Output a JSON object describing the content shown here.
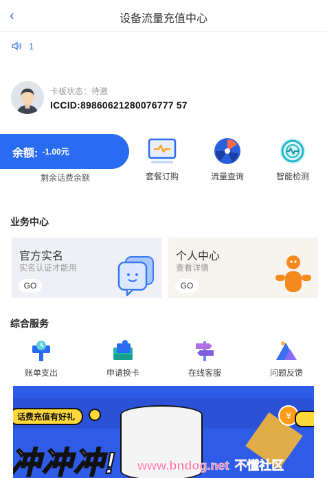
{
  "header": {
    "title": "设备流量充值中心"
  },
  "notice": {
    "text": "1"
  },
  "profile": {
    "status": "卡板状态：待激",
    "iccid": "ICCID:89860621280076777 57"
  },
  "balance": {
    "label": "余额:",
    "amount": "-1.00元",
    "caption": "剩余话费余额"
  },
  "quick_actions": [
    {
      "label": "套餐订购",
      "icon": "monitor-icon"
    },
    {
      "label": "流量查询",
      "icon": "fan-icon"
    },
    {
      "label": "智能检测",
      "icon": "radar-icon"
    }
  ],
  "business": {
    "title": "业务中心",
    "cards": [
      {
        "title": "官方实名",
        "subtitle": "实名认证才能用",
        "go": "GO",
        "icon": "chat-smile-icon",
        "bg": "#eef0f6"
      },
      {
        "title": "个人中心",
        "subtitle": "查看详情",
        "go": "GO",
        "icon": "person-icon",
        "bg": "#f7f3ee"
      }
    ]
  },
  "services": {
    "title": "综合服务",
    "items": [
      {
        "label": "账单支出",
        "icon": "bill-pin-icon"
      },
      {
        "label": "申请换卡",
        "icon": "card-swap-icon"
      },
      {
        "label": "在线客服",
        "icon": "signpost-icon"
      },
      {
        "label": "问题反馈",
        "icon": "feedback-tent-icon"
      }
    ]
  },
  "banner": {
    "pill": "话费充值有好礼",
    "headline": "冲冲冲!",
    "coin": "¥"
  },
  "watermark": {
    "url": "www.bndog.net",
    "name": "不懂社区"
  },
  "colors": {
    "accent": "#2a6cf1",
    "back": "#3a6fe0"
  }
}
